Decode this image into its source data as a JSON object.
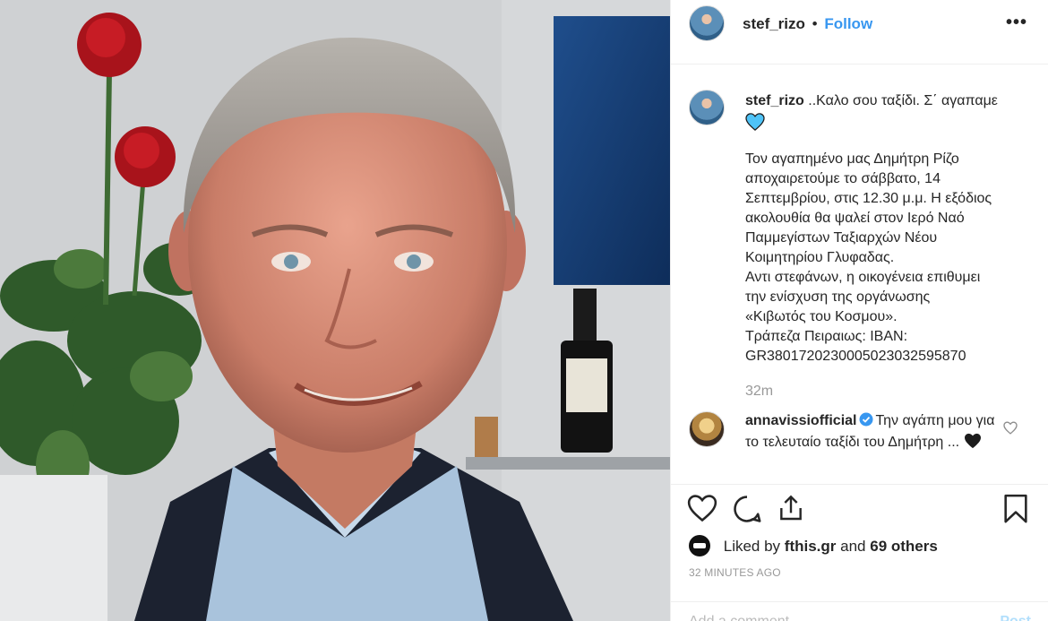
{
  "post": {
    "username": "stef_rizo",
    "dot": "•",
    "follow_label": "Follow",
    "more_label": "•••"
  },
  "caption": {
    "username": "stef_rizo",
    "first_line": "..Καλο σου ταξίδι. Σ΄ αγαπαμε",
    "body": "Τον αγαπημένο μας Δημήτρη Ρίζο\nαποχαιρετούμε το σάββατο, 14\nΣεπτεμβρίου, στις 12.30 μ.μ. Η εξόδιος\nακολουθία θα ψαλεί στον Ιερό Ναό\nΠαμμεγίστων Ταξιαρχών Νέου\nΚοιμητηρίου Γλυφαδας.\nΑντι στεφάνων, η οικογένεια επιθυμει\nτην ενίσχυση της οργάνωσης\n«Κιβωτός του Κοσμου».\nΤράπεζα Πειραιως: IBAN:\nGR3801720230005023032595870",
    "time": "32m"
  },
  "comment": {
    "username": "annavissiofficial",
    "text": "Την αγάπη μου για το τελευταίο ταξίδι του Δημήτρη ..."
  },
  "likes": {
    "prefix": "Liked by",
    "user": "fthis.gr",
    "and": "and",
    "others": "69 others"
  },
  "time_ago": "32 MINUTES AGO",
  "add_comment": {
    "placeholder": "Add a comment...",
    "post_label": "Post"
  },
  "colors": {
    "accent": "#3897f0",
    "text": "#262626",
    "muted": "#999999",
    "heart_blue": "#4fc3f7"
  }
}
